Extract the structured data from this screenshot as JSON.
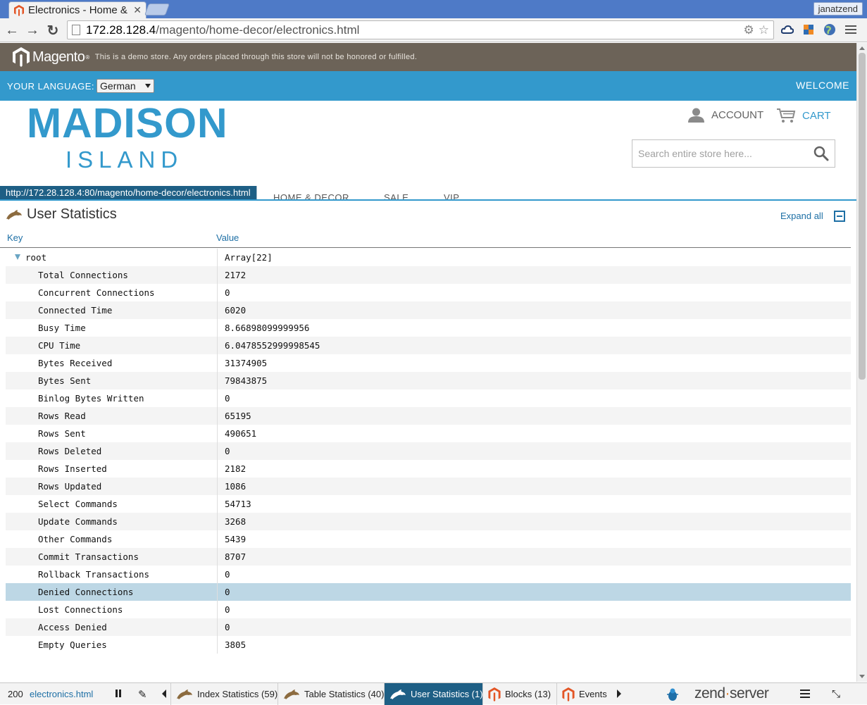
{
  "browser": {
    "tab_title": "Electronics - Home &",
    "profile": "janatzend",
    "url_host": "172.28.128.4",
    "url_path": "/magento/home-decor/electronics.html"
  },
  "store": {
    "logo_text": "Magento",
    "demo_notice": "This is a demo store. Any orders placed through this store will not be honored or fulfilled.",
    "language_label": "YOUR LANGUAGE:",
    "language_value": "German",
    "welcome": "WELCOME",
    "logo_line1": "MADISON",
    "logo_line2": "ISLAND",
    "account": "ACCOUNT",
    "cart": "CART",
    "search_placeholder": "Search entire store here...",
    "status_url": "http://172.28.128.4:80/magento/home-decor/electronics.html",
    "nav": [
      "HOME & DECOR",
      "SALE",
      "VIP"
    ],
    "colors": {
      "brand_blue": "#3399cc",
      "demo_bar": "#6c6358"
    }
  },
  "panel": {
    "title": "User Statistics",
    "expand_all": "Expand all",
    "key_header": "Key",
    "value_header": "Value",
    "root_key": "root",
    "root_value": "Array[22]",
    "rows": [
      {
        "key": "Total Connections",
        "value": "2172"
      },
      {
        "key": "Concurrent Connections",
        "value": "0"
      },
      {
        "key": "Connected Time",
        "value": "6020"
      },
      {
        "key": "Busy Time",
        "value": "8.66898099999956"
      },
      {
        "key": "CPU Time",
        "value": "6.0478552999998545"
      },
      {
        "key": "Bytes Received",
        "value": "31374905"
      },
      {
        "key": "Bytes Sent",
        "value": "79843875"
      },
      {
        "key": "Binlog Bytes Written",
        "value": "0"
      },
      {
        "key": "Rows Read",
        "value": "65195"
      },
      {
        "key": "Rows Sent",
        "value": "490651"
      },
      {
        "key": "Rows Deleted",
        "value": "0"
      },
      {
        "key": "Rows Inserted",
        "value": "2182"
      },
      {
        "key": "Rows Updated",
        "value": "1086"
      },
      {
        "key": "Select Commands",
        "value": "54713"
      },
      {
        "key": "Update Commands",
        "value": "3268"
      },
      {
        "key": "Other Commands",
        "value": "5439"
      },
      {
        "key": "Commit Transactions",
        "value": "8707"
      },
      {
        "key": "Rollback Transactions",
        "value": "0"
      },
      {
        "key": "Denied Connections",
        "value": "0",
        "selected": true
      },
      {
        "key": "Lost Connections",
        "value": "0"
      },
      {
        "key": "Access Denied",
        "value": "0"
      },
      {
        "key": "Empty Queries",
        "value": "3805"
      }
    ]
  },
  "zend_toolbar": {
    "status_code": "200",
    "file": "electronics.html",
    "tabs": [
      {
        "label": "Index Statistics (59)",
        "icon": "dolphin-icon"
      },
      {
        "label": "Table Statistics (40)",
        "icon": "dolphin-icon"
      },
      {
        "label": "User Statistics (1)",
        "icon": "dolphin-icon",
        "active": true
      },
      {
        "label": "Blocks (13)",
        "icon": "magento-icon"
      },
      {
        "label": "Events",
        "icon": "magento-icon"
      }
    ],
    "logo_text": "zend",
    "logo_suffix": "server"
  }
}
